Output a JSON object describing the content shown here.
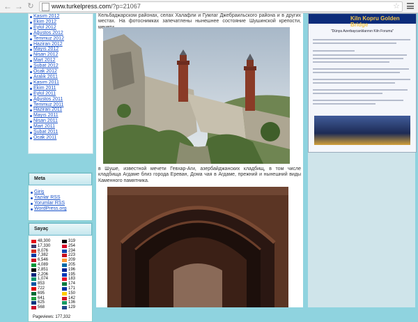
{
  "browser": {
    "url_host": "www.turkelpress.com",
    "url_path": "/?p=21067"
  },
  "archive": {
    "items": [
      "Kasım 2012",
      "Ekim 2012",
      "Eylül 2012",
      "Ağustos 2012",
      "Temmuz 2012",
      "Haziran 2012",
      "Mayıs 2012",
      "Nisan 2012",
      "Mart 2012",
      "Şubat 2012",
      "Ocak 2012",
      "Aralık 2011",
      "Kasım 2011",
      "Ekim 2011",
      "Eylül 2011",
      "Ağustos 2011",
      "Temmuz 2011",
      "Haziran 2011",
      "Mayıs 2011",
      "Nisan 2011",
      "Mart 2011",
      "Şubat 2011",
      "Ocak 2011"
    ]
  },
  "meta": {
    "title": "Meta",
    "links": [
      "Giriş",
      "Yazılar RSS",
      "Yorumlar RSS",
      "WordPress.org"
    ]
  },
  "counter": {
    "title": "Sayaç",
    "left": [
      {
        "value": "48,300",
        "color": "#e30a17"
      },
      {
        "value": "17,330",
        "color": "#3c3b6e"
      },
      {
        "value": "8,076",
        "color": "#d52b1e"
      },
      {
        "value": "7,382",
        "color": "#0039a6"
      },
      {
        "value": "6,546",
        "color": "#ce1126"
      },
      {
        "value": "4,089",
        "color": "#009739"
      },
      {
        "value": "2,851",
        "color": "#000000"
      },
      {
        "value": "2,206",
        "color": "#00247d"
      },
      {
        "value": "1,074",
        "color": "#00966e"
      },
      {
        "value": "853",
        "color": "#0055a4"
      },
      {
        "value": "722",
        "color": "#dd0000"
      },
      {
        "value": "695",
        "color": "#006c35"
      },
      {
        "value": "641",
        "color": "#239f40"
      },
      {
        "value": "625",
        "color": "#003580"
      },
      {
        "value": "568",
        "color": "#c8102e"
      }
    ],
    "right": [
      {
        "value": "319",
        "color": "#000000"
      },
      {
        "value": "254",
        "color": "#d80027"
      },
      {
        "value": "234",
        "color": "#0f47af"
      },
      {
        "value": "223",
        "color": "#c60b1e"
      },
      {
        "value": "209",
        "color": "#ff9933"
      },
      {
        "value": "205",
        "color": "#006aa7"
      },
      {
        "value": "196",
        "color": "#002395"
      },
      {
        "value": "195",
        "color": "#0038b8"
      },
      {
        "value": "183",
        "color": "#e8112d"
      },
      {
        "value": "174",
        "color": "#007a3d"
      },
      {
        "value": "171",
        "color": "#0032a0"
      },
      {
        "value": "150",
        "color": "#ffcd00"
      },
      {
        "value": "142",
        "color": "#ce1126"
      },
      {
        "value": "136",
        "color": "#169b62"
      },
      {
        "value": "129",
        "color": "#21468b"
      }
    ],
    "total_label": "Pageviews: 177,332"
  },
  "article": {
    "para1": "Кельбаджарском районах, селах Халафли и Гумлаг Джебраильского района и в других местах. На фотоснимках запечатлены нынешнее состояние Шушинской крепости, мечети",
    "para2": "в Шуше, известной мечети Гевхар-Аги, азербайджанских кладбищ, в том числе кладбища Агдаме близ города Ереван, Дома чая в Агдаме, прежний и нынешний виды Каменного памятника."
  },
  "banner": {
    "title": "Kiln Kopru Golden Bridge",
    "heading": "\"Dünya Azerbaycanlılarının Kiln Forumu\""
  }
}
